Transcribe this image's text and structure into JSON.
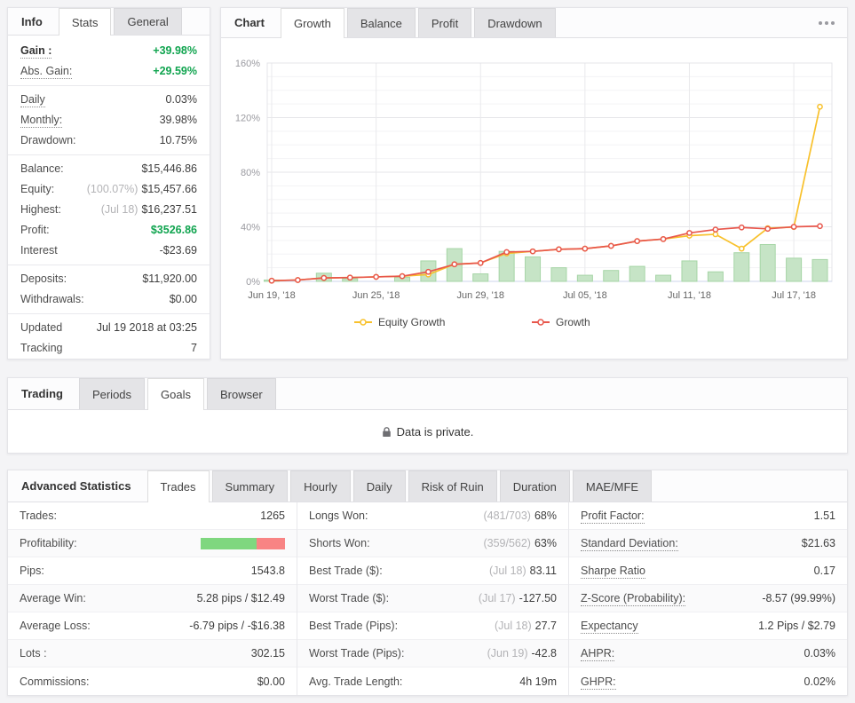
{
  "colors": {
    "accent_green_text": "#10a44f",
    "profitability_win": "#7fd77f",
    "profitability_loss": "#f88484",
    "muted_prefix": "#b3b3b6"
  },
  "info_panel": {
    "tabs": [
      {
        "label": "Info",
        "role": "title"
      },
      {
        "label": "Stats",
        "active": true
      },
      {
        "label": "General"
      }
    ],
    "sections": [
      [
        {
          "label": "Gain :",
          "label_bold": true,
          "dotted": true,
          "value": "+39.98%",
          "green": true
        },
        {
          "label": "Abs. Gain:",
          "dotted": true,
          "value": "+29.59%",
          "green": true
        }
      ],
      [
        {
          "label": "Daily",
          "dotted": true,
          "value": "0.03%"
        },
        {
          "label": "Monthly:",
          "dotted": true,
          "value": "39.98%"
        },
        {
          "label": "Drawdown:",
          "value": "10.75%"
        }
      ],
      [
        {
          "label": "Balance:",
          "value": "$15,446.86"
        },
        {
          "label": "Equity:",
          "prefix": "(100.07%)",
          "value": "$15,457.66"
        },
        {
          "label": "Highest:",
          "prefix": "(Jul 18)",
          "value": "$16,237.51"
        },
        {
          "label": "Profit:",
          "value": "$3526.86",
          "green": true
        },
        {
          "label": "Interest",
          "value": "-$23.69"
        }
      ],
      [
        {
          "label": "Deposits:",
          "value": "$11,920.00"
        },
        {
          "label": "Withdrawals:",
          "value": "$0.00"
        }
      ],
      [
        {
          "label": "Updated",
          "value": "Jul 19 2018 at 03:25"
        },
        {
          "label": "Tracking",
          "value": "7"
        }
      ]
    ]
  },
  "chart_panel": {
    "tabs": [
      {
        "label": "Chart",
        "role": "title"
      },
      {
        "label": "Growth",
        "active": true
      },
      {
        "label": "Balance"
      },
      {
        "label": "Profit"
      },
      {
        "label": "Drawdown"
      }
    ],
    "menu_icon": "ellipsis-icon"
  },
  "chart_data": {
    "type": "line+bar",
    "x": [
      "Jun 19",
      "Jun 20",
      "Jun 21",
      "Jun 22",
      "Jun 25",
      "Jun 26",
      "Jun 27",
      "Jun 28",
      "Jun 29",
      "Jul 02",
      "Jul 03",
      "Jul 04",
      "Jul 05",
      "Jul 06",
      "Jul 09",
      "Jul 10",
      "Jul 11",
      "Jul 12",
      "Jul 13",
      "Jul 16",
      "Jul 17",
      "Jul 18"
    ],
    "x_tick_indices": [
      0,
      4,
      8,
      12,
      16,
      20
    ],
    "x_tick_labels": [
      "Jun 19, '18",
      "Jun 25, '18",
      "Jun 29, '18",
      "Jul 05, '18",
      "Jul 11, '18",
      "Jul 17, '18"
    ],
    "ylim": [
      0,
      160
    ],
    "y_tick_values": [
      0,
      40,
      80,
      120,
      160
    ],
    "y_tick_labels": [
      "0%",
      "40%",
      "80%",
      "120%",
      "160%"
    ],
    "grid": true,
    "legend_position": "bottom",
    "series": [
      {
        "name": "Equity Growth",
        "type": "line",
        "color": "#f8c12c",
        "values": [
          0.5,
          1,
          2.5,
          2.8,
          3.3,
          3.8,
          5,
          12.5,
          13.5,
          20.5,
          22,
          23.5,
          24,
          26,
          29.5,
          31,
          33.5,
          34.5,
          24,
          39,
          39.8,
          128
        ]
      },
      {
        "name": "Growth",
        "type": "line",
        "color": "#e8574c",
        "values": [
          0.5,
          1,
          2.5,
          2.8,
          3.3,
          3.8,
          7,
          12.5,
          13.5,
          21.5,
          22,
          23.5,
          24,
          26,
          29.5,
          31,
          35.5,
          38,
          39.5,
          38.5,
          40,
          40.5
        ]
      },
      {
        "name": "Profit",
        "type": "bar",
        "color": "#c6e4c6",
        "border_color": "#a6d5a6",
        "values": [
          1,
          0,
          6,
          2,
          0,
          3,
          15,
          24,
          5.5,
          22,
          18,
          10,
          4.5,
          8,
          11,
          4.5,
          15,
          7,
          21,
          27,
          17,
          16
        ]
      }
    ]
  },
  "privacy_panel": {
    "tabs": [
      {
        "label": "Trading",
        "role": "title"
      },
      {
        "label": "Periods"
      },
      {
        "label": "Goals",
        "active": true
      },
      {
        "label": "Browser"
      }
    ],
    "lock_icon": "lock-icon",
    "message": "Data is private."
  },
  "stats_panel": {
    "tabs": [
      {
        "label": "Advanced Statistics",
        "role": "title"
      },
      {
        "label": "Trades",
        "active": true
      },
      {
        "label": "Summary"
      },
      {
        "label": "Hourly"
      },
      {
        "label": "Daily"
      },
      {
        "label": "Risk of Ruin"
      },
      {
        "label": "Duration"
      },
      {
        "label": "MAE/MFE"
      }
    ],
    "profitability": {
      "wins_pct": 66,
      "losses_pct": 34
    },
    "columns": [
      {
        "rows": [
          {
            "label": "Trades:",
            "value": "1265"
          },
          {
            "label": "Profitability:",
            "bar": true
          },
          {
            "label": "Pips:",
            "value": "1543.8"
          },
          {
            "label": "Average Win:",
            "value": "5.28 pips / $12.49"
          },
          {
            "label": "Average Loss:",
            "value": "-6.79 pips / -$16.38"
          },
          {
            "label": "Lots :",
            "value": "302.15"
          },
          {
            "label": "Commissions:",
            "value": "$0.00"
          }
        ]
      },
      {
        "rows": [
          {
            "label": "Longs Won:",
            "prefix": "(481/703)",
            "value": "68%"
          },
          {
            "label": "Shorts Won:",
            "prefix": "(359/562)",
            "value": "63%"
          },
          {
            "label": "Best Trade ($):",
            "prefix": "(Jul 18)",
            "value": "83.11"
          },
          {
            "label": "Worst Trade ($):",
            "prefix": "(Jul 17)",
            "value": "-127.50"
          },
          {
            "label": "Best Trade (Pips):",
            "prefix": "(Jul 18)",
            "value": "27.7"
          },
          {
            "label": "Worst Trade (Pips):",
            "prefix": "(Jun 19)",
            "value": "-42.8"
          },
          {
            "label": "Avg. Trade Length:",
            "value": "4h 19m"
          }
        ]
      },
      {
        "rows": [
          {
            "label": "Profit Factor:",
            "dotted": true,
            "value": "1.51"
          },
          {
            "label": "Standard Deviation:",
            "dotted": true,
            "value": "$21.63"
          },
          {
            "label": "Sharpe Ratio",
            "dotted": true,
            "value": "0.17"
          },
          {
            "label": "Z-Score (Probability):",
            "dotted": true,
            "value": "-8.57 (99.99%)"
          },
          {
            "label": "Expectancy",
            "dotted": true,
            "value": "1.2 Pips / $2.79"
          },
          {
            "label": "AHPR:",
            "dotted": true,
            "value": "0.03%"
          },
          {
            "label": "GHPR:",
            "dotted": true,
            "value": "0.02%"
          }
        ]
      }
    ]
  }
}
